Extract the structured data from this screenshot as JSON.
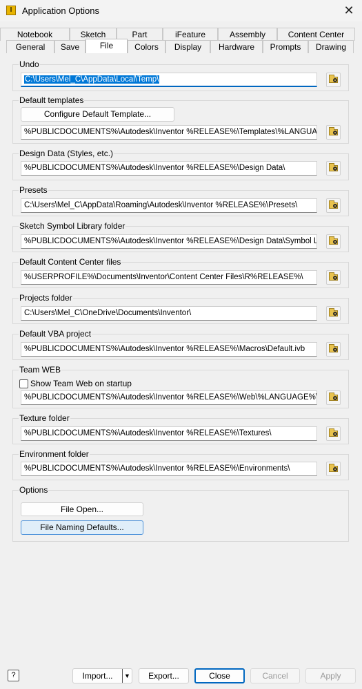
{
  "window": {
    "title": "Application Options",
    "app_icon_letter": "I",
    "close_glyph": "✕"
  },
  "tabs": {
    "back_row": [
      "Notebook",
      "Sketch",
      "Part",
      "iFeature",
      "Assembly",
      "Content Center"
    ],
    "front_row": [
      "General",
      "Save",
      "File",
      "Colors",
      "Display",
      "Hardware",
      "Prompts",
      "Drawing"
    ],
    "active": "File"
  },
  "groups": {
    "undo": {
      "label": "Undo",
      "path": "C:\\Users\\Mel_C\\AppData\\Local\\Temp\\"
    },
    "default_templates": {
      "label": "Default templates",
      "configure_button": "Configure Default Template...",
      "path": "%PUBLICDOCUMENTS%\\Autodesk\\Inventor %RELEASE%\\Templates\\%LANGUAGE%\\"
    },
    "design_data": {
      "label": "Design Data (Styles, etc.)",
      "path": "%PUBLICDOCUMENTS%\\Autodesk\\Inventor %RELEASE%\\Design Data\\"
    },
    "presets": {
      "label": "Presets",
      "path": "C:\\Users\\Mel_C\\AppData\\Roaming\\Autodesk\\Inventor %RELEASE%\\Presets\\"
    },
    "sketch_symbol": {
      "label": "Sketch Symbol Library folder",
      "path": "%PUBLICDOCUMENTS%\\Autodesk\\Inventor %RELEASE%\\Design Data\\Symbol Library\\"
    },
    "content_center": {
      "label": "Default Content Center files",
      "path": "%USERPROFILE%\\Documents\\Inventor\\Content Center Files\\R%RELEASE%\\"
    },
    "projects": {
      "label": "Projects folder",
      "path": "C:\\Users\\Mel_C\\OneDrive\\Documents\\Inventor\\"
    },
    "vba": {
      "label": "Default VBA project",
      "path": "%PUBLICDOCUMENTS%\\Autodesk\\Inventor %RELEASE%\\Macros\\Default.ivb"
    },
    "team_web": {
      "label": "Team WEB",
      "checkbox_label": "Show Team Web on startup",
      "checked": false,
      "path": "%PUBLICDOCUMENTS%\\Autodesk\\Inventor %RELEASE%\\Web\\%LANGUAGE%\\Custom"
    },
    "texture": {
      "label": "Texture folder",
      "path": "%PUBLICDOCUMENTS%\\Autodesk\\Inventor %RELEASE%\\Textures\\"
    },
    "environment": {
      "label": "Environment folder",
      "path": "%PUBLICDOCUMENTS%\\Autodesk\\Inventor %RELEASE%\\Environments\\"
    },
    "options": {
      "label": "Options",
      "file_open_button": "File Open...",
      "file_naming_button": "File Naming Defaults..."
    }
  },
  "footer": {
    "help_glyph": "?",
    "import": "Import...",
    "export": "Export...",
    "close": "Close",
    "cancel": "Cancel",
    "apply": "Apply"
  },
  "icons": {
    "browse": "folder-search-icon",
    "import_dropdown": "chevron-down-icon"
  },
  "colors": {
    "selection": "#0078d7",
    "focus_underline": "#0067c0",
    "highlight_button": "#e0eef9"
  }
}
